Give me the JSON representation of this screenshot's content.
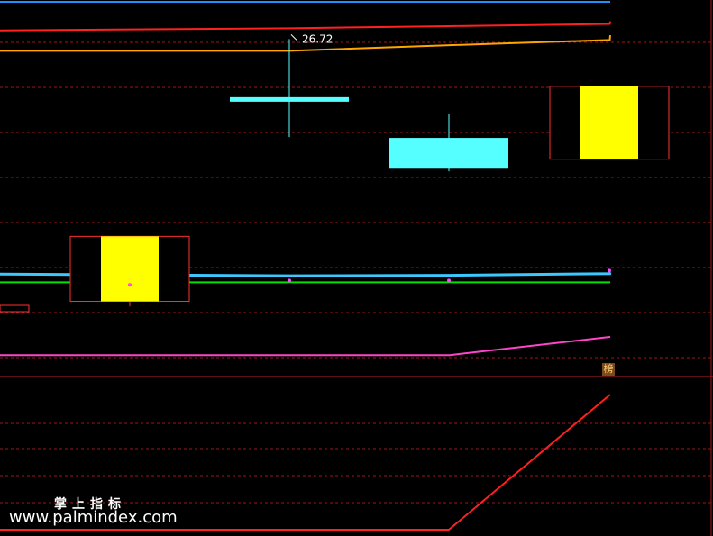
{
  "chart_data": {
    "type": "candlestick",
    "x": [
      0,
      1,
      2,
      3,
      4
    ],
    "ylim": [
      19.33,
      27.58
    ],
    "grid": true,
    "candles": [
      {
        "x": 0,
        "open": 20.67,
        "close": 22.17,
        "high": 22.17,
        "low": 20.55,
        "color": "#ffff00",
        "boxed": true
      },
      {
        "x": 1,
        "open": 25.38,
        "close": 25.28,
        "high": 26.72,
        "low": 24.46,
        "color": "#55ffff"
      },
      {
        "x": 2,
        "open": 24.44,
        "close": 23.73,
        "high": 25.0,
        "low": 23.67,
        "color": "#55ffff"
      },
      {
        "x": 3,
        "open": 23.95,
        "close": 25.63,
        "high": 25.63,
        "low": 23.95,
        "color": "#ffff00",
        "boxed": true
      }
    ],
    "annotations": [
      {
        "x": 1,
        "y": 26.72,
        "text": "26.72"
      }
    ],
    "series": [
      {
        "color": "#1e90ff",
        "values": [
          27.58,
          27.58,
          27.58,
          27.58,
          27.58
        ]
      },
      {
        "color": "#ff2020",
        "values": [
          26.92,
          26.97,
          27.02,
          27.07,
          27.13
        ]
      },
      {
        "color": "#ffa500",
        "values": [
          26.45,
          26.45,
          26.58,
          26.7,
          26.81
        ]
      },
      {
        "color": "#3cc8ff",
        "values": [
          21.3,
          21.26,
          21.27,
          21.31,
          21.34
        ]
      },
      {
        "color": "#00e000",
        "values": [
          21.11,
          21.11,
          21.11,
          21.11,
          21.11
        ]
      },
      {
        "color": "#ff44cc",
        "values": [
          19.43,
          19.43,
          19.43,
          19.85,
          19.85
        ]
      }
    ],
    "markers": [
      {
        "x": 0,
        "y": 21.05
      },
      {
        "x": 1,
        "y": 21.15
      },
      {
        "x": 2,
        "y": 21.15
      },
      {
        "x": 4,
        "y": 21.38
      }
    ]
  },
  "subchart": {
    "ylim": [
      0,
      1
    ],
    "series": [
      {
        "color": "#ff2020",
        "values": [
          0.0,
          0.0,
          0.0,
          0.0,
          1.0
        ]
      }
    ]
  },
  "watermark": {
    "cn": "掌上指标",
    "url": "www.palmindex.com"
  },
  "badge": {
    "text": "榜"
  }
}
